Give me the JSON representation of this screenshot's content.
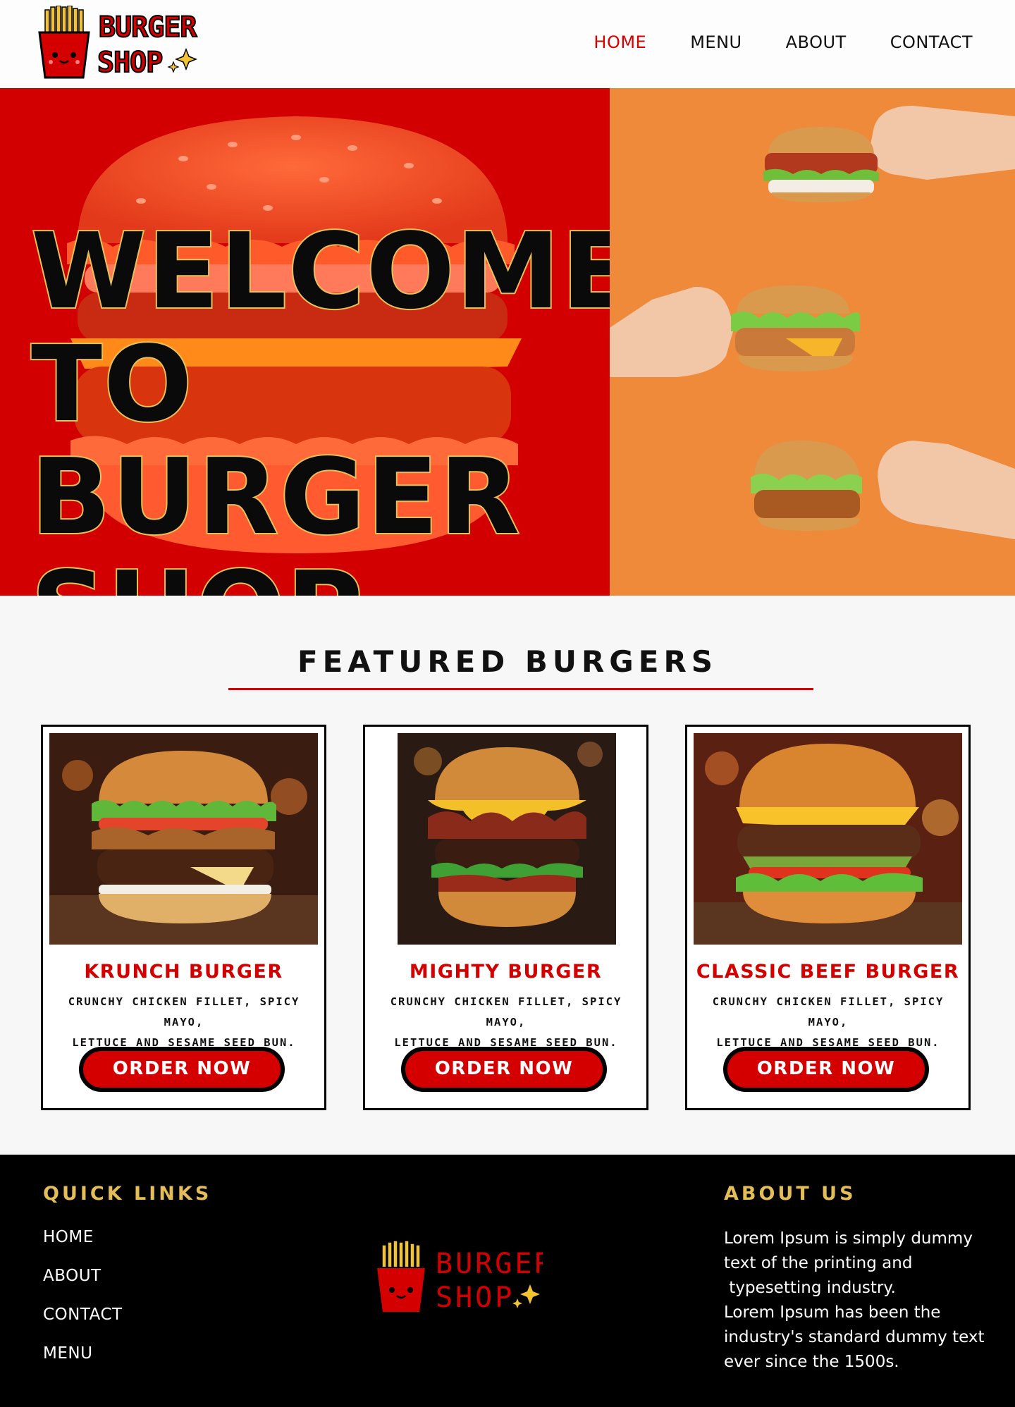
{
  "brand": {
    "logo_line1": "BURGER",
    "logo_line2": "SHOP"
  },
  "nav": {
    "home": "HOME",
    "menu": "MENU",
    "about": "ABOUT",
    "contact": "CONTACT",
    "active": "home"
  },
  "hero": {
    "lines": [
      "WELCOME",
      "TO",
      "BURGER",
      "SHOP"
    ]
  },
  "featured": {
    "title": "FEATURED BURGERS",
    "cards": [
      {
        "name": "KRUNCH BURGER",
        "desc_line1": "CRUNCHY CHICKEN FILLET, SPICY MAYO,",
        "desc_line2": "LETTUCE AND SESAME SEED BUN.",
        "button": "ORDER NOW"
      },
      {
        "name": "MIGHTY BURGER",
        "desc_line1": "CRUNCHY CHICKEN FILLET, SPICY MAYO,",
        "desc_line2": "LETTUCE AND SESAME SEED BUN.",
        "button": "ORDER NOW"
      },
      {
        "name": "CLASSIC BEEF BURGER",
        "desc_line1": "CRUNCHY CHICKEN FILLET, SPICY MAYO,",
        "desc_line2": "LETTUCE AND SESAME SEED BUN.",
        "button": "ORDER NOW"
      }
    ]
  },
  "footer": {
    "quick_links_title": "QUICK LINKS",
    "links": [
      "HOME",
      "ABOUT",
      "CONTACT",
      "MENU"
    ],
    "about_title": "ABOUT US",
    "about_lines": [
      "Lorem Ipsum is simply dummy",
      "text of the printing and",
      " typesetting industry.",
      "Lorem Ipsum has been the",
      "industry's standard dummy text",
      "ever since the 1500s."
    ]
  },
  "colors": {
    "brand_red": "#d40000",
    "hero_orange": "#ee8a3a",
    "gold": "#e3bd57",
    "black": "#000000"
  }
}
